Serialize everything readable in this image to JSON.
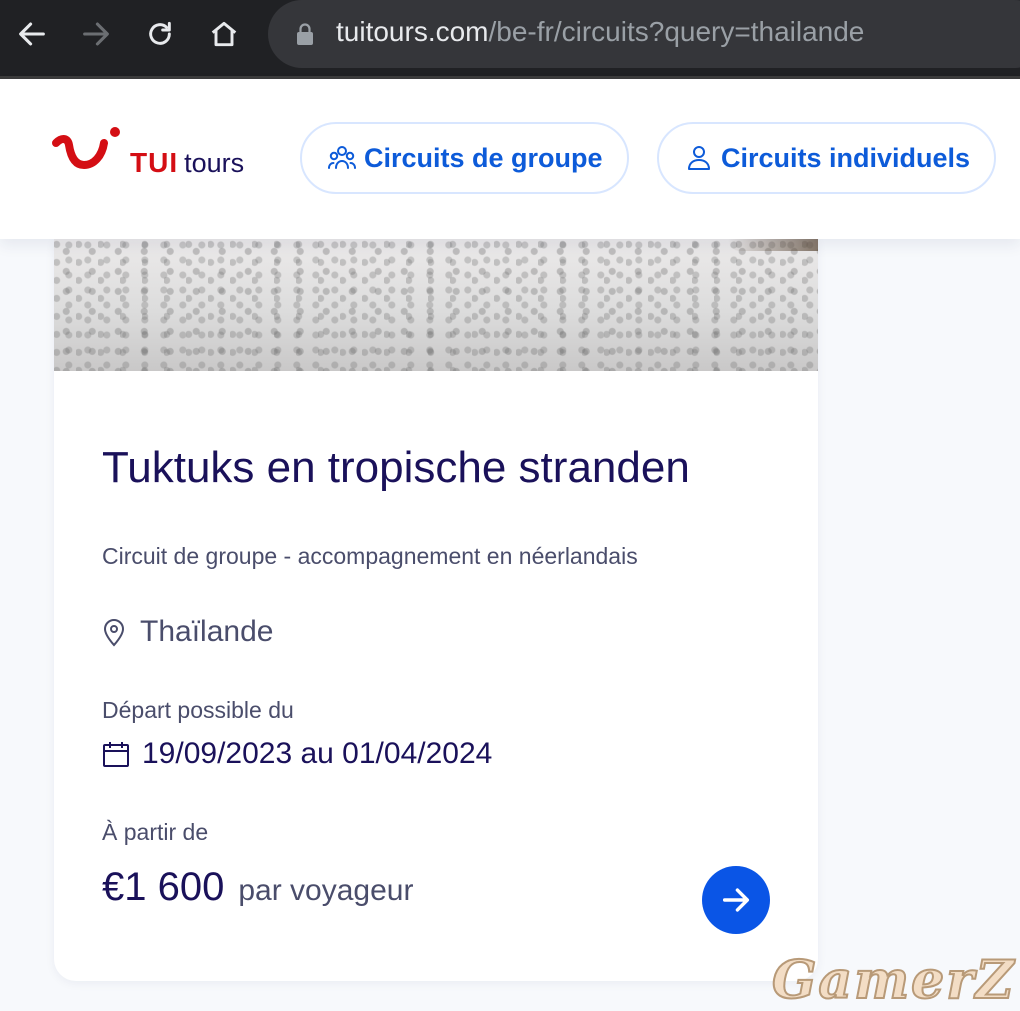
{
  "browser": {
    "url_host": "tuitours.com",
    "url_path": "/be-fr/circuits?query=thailande"
  },
  "header": {
    "logo_tui": "TUI",
    "logo_tours": "tours",
    "nav": [
      {
        "label": "Circuits de groupe",
        "icon": "group-icon"
      },
      {
        "label": "Circuits individuels",
        "icon": "person-icon"
      }
    ]
  },
  "card": {
    "title": "Tuktuks en tropische stranden",
    "subtitle": "Circuit de groupe - accompagnement en néerlandais",
    "location": "Thaïlande",
    "departure_label": "Départ possible du",
    "dates": "19/09/2023 au 01/04/2024",
    "from_label": "À partir de",
    "price": "€1 600",
    "per_label": "par voyageur"
  },
  "watermark": "GamerZ",
  "colors": {
    "brand_red": "#d40e14",
    "brand_navy": "#1a115a",
    "accent_blue": "#0a55e6"
  }
}
